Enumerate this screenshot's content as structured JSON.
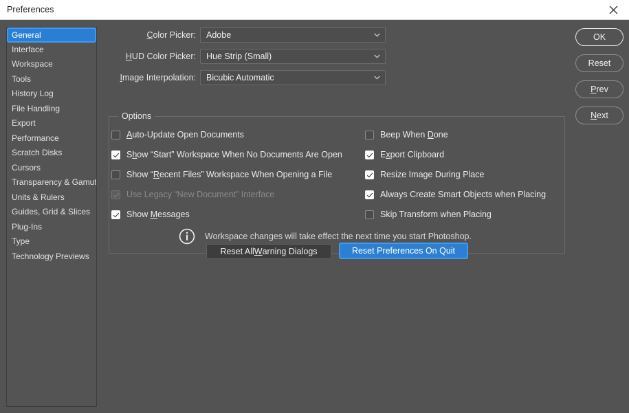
{
  "window": {
    "title": "Preferences",
    "close_icon": "close-icon"
  },
  "sidebar": {
    "items": [
      {
        "label": "General",
        "selected": true
      },
      {
        "label": "Interface",
        "selected": false
      },
      {
        "label": "Workspace",
        "selected": false
      },
      {
        "label": "Tools",
        "selected": false
      },
      {
        "label": "History Log",
        "selected": false
      },
      {
        "label": "File Handling",
        "selected": false
      },
      {
        "label": "Export",
        "selected": false
      },
      {
        "label": "Performance",
        "selected": false
      },
      {
        "label": "Scratch Disks",
        "selected": false
      },
      {
        "label": "Cursors",
        "selected": false
      },
      {
        "label": "Transparency & Gamut",
        "selected": false
      },
      {
        "label": "Units & Rulers",
        "selected": false
      },
      {
        "label": "Guides, Grid & Slices",
        "selected": false
      },
      {
        "label": "Plug-Ins",
        "selected": false
      },
      {
        "label": "Type",
        "selected": false
      },
      {
        "label": "Technology Previews",
        "selected": false
      }
    ]
  },
  "fields": [
    {
      "label_before": "",
      "label_mnemonic": "C",
      "label_after": "olor Picker:",
      "value": "Adobe"
    },
    {
      "label_before": "",
      "label_mnemonic": "H",
      "label_after": "UD Color Picker:",
      "value": "Hue Strip (Small)"
    },
    {
      "label_before": "",
      "label_mnemonic": "I",
      "label_after": "mage Interpolation:",
      "value": "Bicubic Automatic"
    }
  ],
  "options_group": {
    "title": "Options",
    "left_column": [
      {
        "before": "",
        "mnemonic": "A",
        "after": "uto-Update Open Documents",
        "checked": false,
        "disabled": false
      },
      {
        "before": "S",
        "mnemonic": "h",
        "after": "ow “Start” Workspace When No Documents Are Open",
        "checked": true,
        "disabled": false
      },
      {
        "before": "Show “",
        "mnemonic": "R",
        "after": "ecent Files” Workspace When Opening a File",
        "checked": false,
        "disabled": false
      },
      {
        "before": "Use Legacy “New Document” Interface",
        "mnemonic": "",
        "after": "",
        "checked": true,
        "disabled": true
      },
      {
        "before": "Show ",
        "mnemonic": "M",
        "after": "essages",
        "checked": true,
        "disabled": false
      }
    ],
    "right_column": [
      {
        "before": "Beep When ",
        "mnemonic": "D",
        "after": "one",
        "checked": false,
        "disabled": false
      },
      {
        "before": "E",
        "mnemonic": "x",
        "after": "port Clipboard",
        "checked": true,
        "disabled": false
      },
      {
        "before": "Resize Image Durin",
        "mnemonic": "g",
        "after": " Place",
        "checked": true,
        "disabled": false
      },
      {
        "before": "Always Create Smart Ob",
        "mnemonic": "j",
        "after": "ects when Placing",
        "checked": true,
        "disabled": false
      },
      {
        "before": "Skip Transform when Placing",
        "mnemonic": "",
        "after": "",
        "checked": false,
        "disabled": false
      }
    ]
  },
  "info_note": {
    "icon": "info-icon",
    "text": "Workspace changes will take effect the next time you start Photoshop."
  },
  "bottom_buttons": [
    {
      "before": "Reset All ",
      "mnemonic": "W",
      "after": "arning Dialogs",
      "focused": false
    },
    {
      "before": "Reset Preferences On Quit",
      "mnemonic": "",
      "after": "",
      "focused": true
    }
  ],
  "action_buttons": [
    {
      "before": "OK",
      "mnemonic": "",
      "after": "",
      "primary": true
    },
    {
      "before": "Reset",
      "mnemonic": "",
      "after": "",
      "primary": false
    },
    {
      "before": "",
      "mnemonic": "P",
      "after": "rev",
      "primary": false
    },
    {
      "before": "",
      "mnemonic": "N",
      "after": "ext",
      "primary": false
    }
  ],
  "colors": {
    "dialog_bg": "#535353",
    "titlebar_bg": "#ffffff",
    "accent_blue": "#2a7fd4",
    "focus_blue": "#3e9bf0",
    "text": "#e8e8e8",
    "disabled_text": "#8a8a8a"
  }
}
